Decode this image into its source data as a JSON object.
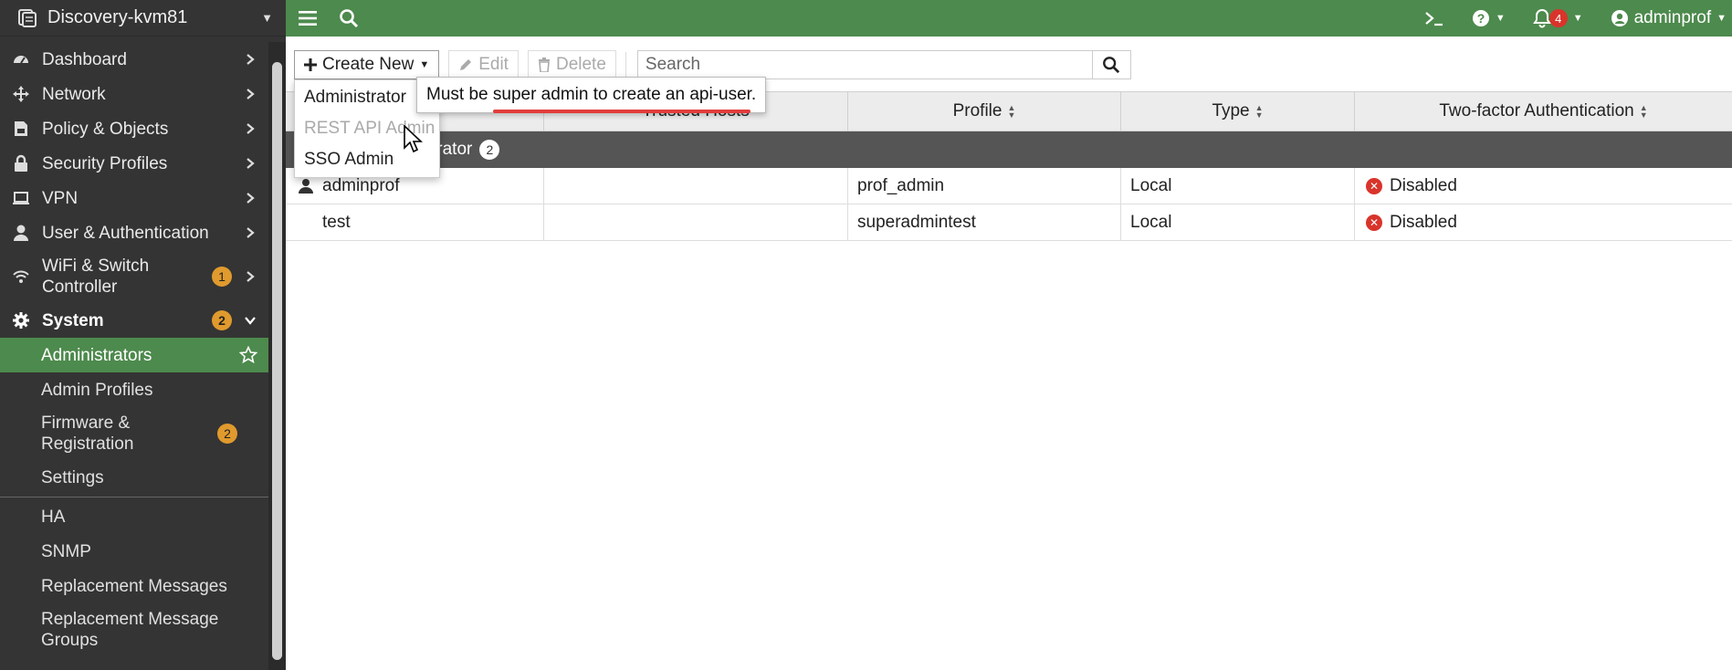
{
  "sidebar": {
    "hostname": "Discovery-kvm81",
    "items": [
      {
        "label": "Dashboard",
        "icon": "dashboard-icon"
      },
      {
        "label": "Network",
        "icon": "network-icon"
      },
      {
        "label": "Policy & Objects",
        "icon": "policy-icon"
      },
      {
        "label": "Security Profiles",
        "icon": "lock-icon"
      },
      {
        "label": "VPN",
        "icon": "laptop-icon"
      },
      {
        "label": "User & Authentication",
        "icon": "user-icon"
      },
      {
        "label": "WiFi & Switch Controller",
        "icon": "wifi-icon",
        "badge": "1"
      },
      {
        "label": "System",
        "icon": "gear-icon",
        "badge": "2"
      }
    ],
    "system_sub": [
      {
        "label": "Administrators"
      },
      {
        "label": "Admin Profiles"
      },
      {
        "label": "Firmware & Registration",
        "badge": "2"
      },
      {
        "label": "Settings"
      },
      {
        "label": "HA"
      },
      {
        "label": "SNMP"
      },
      {
        "label": "Replacement Messages"
      },
      {
        "label": "Replacement Message Groups"
      }
    ]
  },
  "topbar": {
    "notifications_count": "4",
    "user": "adminprof"
  },
  "toolbar": {
    "create_new": "Create New",
    "edit": "Edit",
    "delete": "Delete",
    "search_placeholder": "Search"
  },
  "create_menu": {
    "items": [
      "Administrator",
      "REST API Admin",
      "SSO Admin"
    ]
  },
  "tooltip": {
    "prefix": "Must be ",
    "underlined": "super admin to create an api-user."
  },
  "table": {
    "headers": {
      "hosts": "Trusted Hosts",
      "profile": "Profile",
      "type": "Type",
      "twofa": "Two-factor Authentication"
    },
    "group": {
      "label": "System Administrator",
      "visible_label": "trator",
      "count": "2"
    },
    "rows": [
      {
        "name": "adminprof",
        "hosts": "",
        "profile": "prof_admin",
        "type": "Local",
        "twofa": "Disabled"
      },
      {
        "name": "test",
        "hosts": "",
        "profile": "superadmintest",
        "type": "Local",
        "twofa": "Disabled"
      }
    ]
  },
  "colors": {
    "accent_green": "#4d8a4d",
    "sidebar_bg": "#343434",
    "badge_orange": "#e09a2d",
    "alert_red": "#d9342b"
  }
}
